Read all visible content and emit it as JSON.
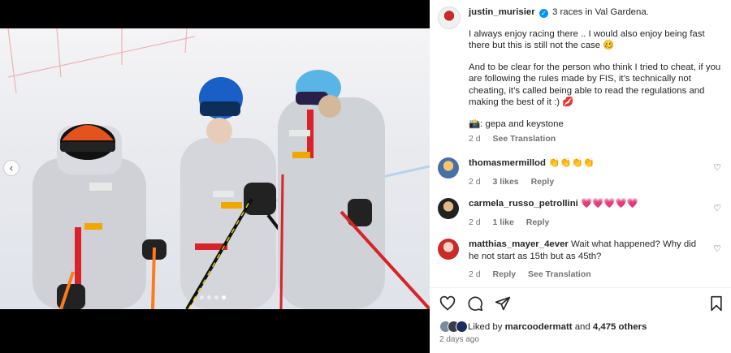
{
  "post": {
    "author": "justin_murisier",
    "caption_lead": "3 races in Val Gardena.",
    "caption_p1": "I always enjoy racing there .. I would also enjoy being fast there but this is still not the case 🥴",
    "caption_p2": "And to be clear for the person who think I tried to cheat, if you are following the rules made by FIS, it’s technically not cheating, it’s called being able to read the regulations and making the best of it :) 💋",
    "caption_credit": "📸: gepa and keystone",
    "caption_time": "2 d",
    "see_translation": "See Translation"
  },
  "comments": [
    {
      "user": "thomasmermillod",
      "text": "👏👏👏👏",
      "time": "2 d",
      "likes": "3 likes",
      "reply": "Reply"
    },
    {
      "user": "carmela_russo_petrollini",
      "text": "💗💗💗💗💗",
      "time": "2 d",
      "likes": "1 like",
      "reply": "Reply"
    },
    {
      "user": "matthias_mayer_4ever",
      "text": "Wait what happened? Why did he not start as 15th but as 45th?",
      "time": "2 d",
      "reply": "Reply",
      "translate": "See Translation"
    }
  ],
  "likes": {
    "prefix": "Liked by",
    "user": "marcoodermatt",
    "joiner": "and",
    "count": "4,475 others"
  },
  "posted": "2 days ago",
  "icons": {
    "like": "heart-icon",
    "comment": "comment-icon",
    "share": "share-icon",
    "save": "bookmark-icon",
    "prev": "chevron-left-icon"
  },
  "colors": {
    "verified": "#0095f6",
    "suit_red": "#d8232a",
    "meta": "#737373"
  },
  "carousel": {
    "count": 4,
    "active": 4
  }
}
